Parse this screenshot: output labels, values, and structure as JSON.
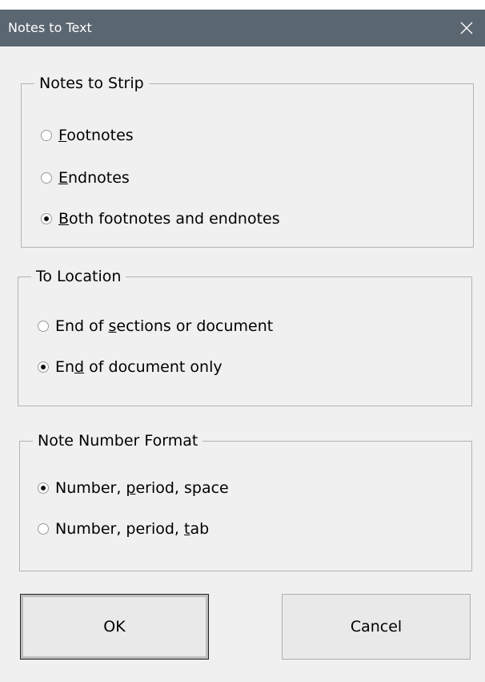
{
  "window": {
    "title": "Notes to Text",
    "close_icon": "close-icon"
  },
  "groups": {
    "notes_to_strip": {
      "label": "Notes to Strip",
      "options": [
        {
          "pre": "",
          "accel": "F",
          "post": "ootnotes",
          "checked": false
        },
        {
          "pre": "",
          "accel": "E",
          "post": "ndnotes",
          "checked": false
        },
        {
          "pre": "",
          "accel": "B",
          "post": "oth footnotes and endnotes",
          "checked": true
        }
      ]
    },
    "to_location": {
      "label": "To Location",
      "options": [
        {
          "pre": "End of ",
          "accel": "s",
          "post": "ections or document",
          "checked": false
        },
        {
          "pre": "En",
          "accel": "d",
          "post": " of document only",
          "checked": true
        }
      ]
    },
    "note_number_format": {
      "label": "Note Number Format",
      "options": [
        {
          "pre": "Number, ",
          "accel": "p",
          "post": "eriod, space",
          "checked": true
        },
        {
          "pre": "Number, period, ",
          "accel": "t",
          "post": "ab",
          "checked": false
        }
      ]
    }
  },
  "buttons": {
    "ok": "OK",
    "cancel": "Cancel"
  }
}
